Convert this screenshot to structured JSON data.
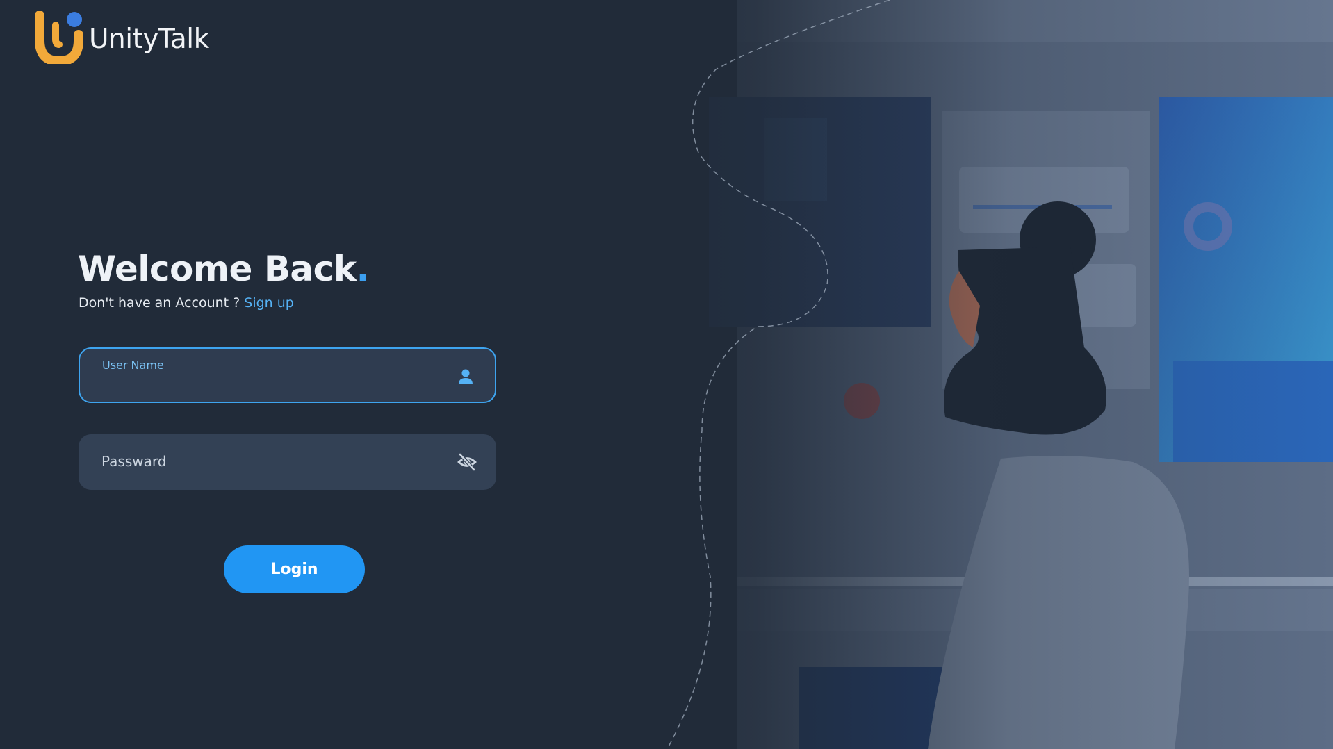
{
  "brand": {
    "name_bold": "Unity",
    "name_light": "Talk"
  },
  "heading": {
    "title": "Welcome Back",
    "dot": "."
  },
  "signup": {
    "prompt": "Don't have an Account ? ",
    "link": "Sign up"
  },
  "form": {
    "username": {
      "label": "User Name",
      "value": ""
    },
    "password": {
      "placeholder": "Passward",
      "value": ""
    },
    "login_label": "Login"
  },
  "colors": {
    "background": "#212b39",
    "accent": "#2196f3",
    "field": "#334155",
    "logo_orange": "#f2a93a",
    "logo_blue": "#3b7de0"
  },
  "icons": {
    "username": "user-icon",
    "password": "eye-slash-icon",
    "logo": "unitytalk-logo-mark"
  }
}
